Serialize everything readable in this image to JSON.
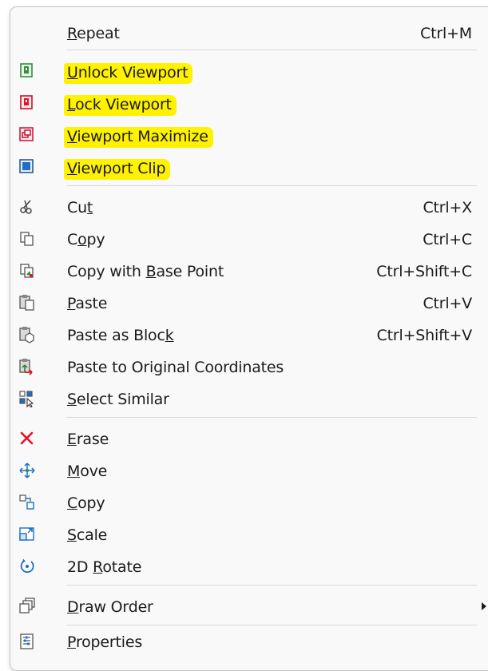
{
  "menu": {
    "repeat": {
      "label": "Repeat",
      "shortcut": "Ctrl+M",
      "access_key": "R"
    },
    "unlock_viewport": {
      "label": "Unlock Viewport",
      "access_key": "U",
      "icon": "unlock-viewport-icon"
    },
    "lock_viewport": {
      "label": "Lock Viewport",
      "access_key": "L",
      "icon": "lock-viewport-icon"
    },
    "viewport_maximize": {
      "label": "Viewport Maximize",
      "access_key": "V",
      "icon": "viewport-maximize-icon"
    },
    "viewport_clip": {
      "label": "Viewport Clip",
      "access_key": "V",
      "icon": "viewport-clip-icon"
    },
    "cut": {
      "label": "Cut",
      "shortcut": "Ctrl+X",
      "access_key": "t",
      "icon": "scissors-icon"
    },
    "copy_clip": {
      "label": "Copy",
      "shortcut": "Ctrl+C",
      "access_key": "o",
      "icon": "copy-icon"
    },
    "copy_base": {
      "label": "Copy with Base Point",
      "shortcut": "Ctrl+Shift+C",
      "access_key": "B",
      "icon": "copy-base-point-icon"
    },
    "paste": {
      "label": "Paste",
      "shortcut": "Ctrl+V",
      "access_key": "P",
      "icon": "paste-icon"
    },
    "paste_block": {
      "label": "Paste as Block",
      "shortcut": "Ctrl+Shift+V",
      "access_key": "k",
      "icon": "paste-as-block-icon"
    },
    "paste_orig": {
      "label": "Paste to Original Coordinates",
      "access_key": "g",
      "icon": "paste-original-coordinates-icon"
    },
    "select_similar": {
      "label": "Select Similar",
      "access_key": "S",
      "icon": "select-similar-icon"
    },
    "erase": {
      "label": "Erase",
      "access_key": "E",
      "icon": "erase-x-icon"
    },
    "move": {
      "label": "Move",
      "access_key": "M",
      "icon": "move-arrows-icon"
    },
    "copy_obj": {
      "label": "Copy",
      "access_key": "C",
      "icon": "copy-objects-icon"
    },
    "scale": {
      "label": "Scale",
      "access_key": "S",
      "icon": "scale-icon"
    },
    "rotate": {
      "label": "2D Rotate",
      "access_key": "R",
      "icon": "rotate-icon"
    },
    "draw_order": {
      "label": "Draw Order",
      "access_key": "D",
      "icon": "draw-order-icon",
      "has_submenu": true
    },
    "properties": {
      "label": "Properties",
      "access_key": "P",
      "icon": "properties-icon"
    }
  },
  "colors": {
    "highlight": "#fff200",
    "menu_background": "#f9f9f9",
    "separator": "#d9d9d9",
    "erase_red": "#e81123",
    "icon_blue": "#1e6fc4",
    "icon_green": "#2f8f3a"
  }
}
